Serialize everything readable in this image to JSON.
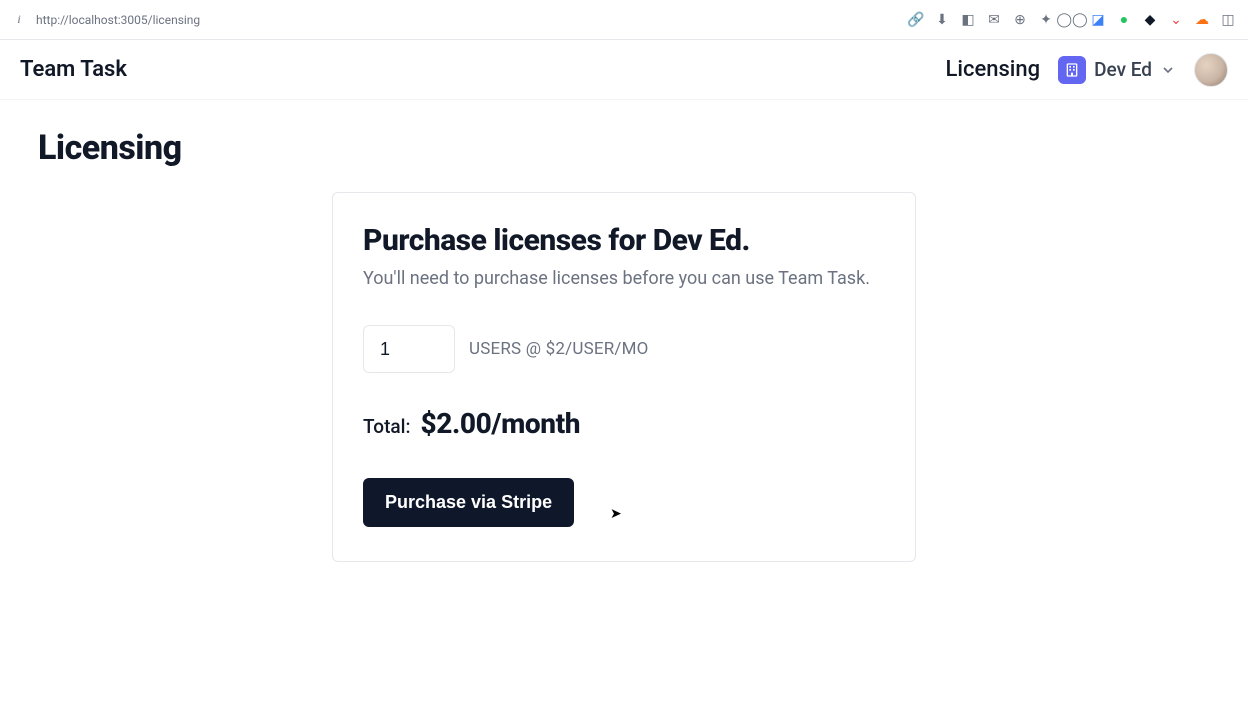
{
  "browser": {
    "url": "http://localhost:3005/licensing"
  },
  "header": {
    "app_name": "Team Task",
    "nav_label": "Licensing",
    "org_name": "Dev Ed"
  },
  "page": {
    "heading": "Licensing"
  },
  "card": {
    "title": "Purchase licenses for Dev Ed.",
    "subtitle": "You'll need to purchase licenses before you can use Team Task.",
    "quantity_value": "1",
    "pricing_text": "USERS @ $2/USER/MO",
    "total_label": "Total:",
    "total_value": "$2.00/month",
    "purchase_button_label": "Purchase via Stripe"
  }
}
